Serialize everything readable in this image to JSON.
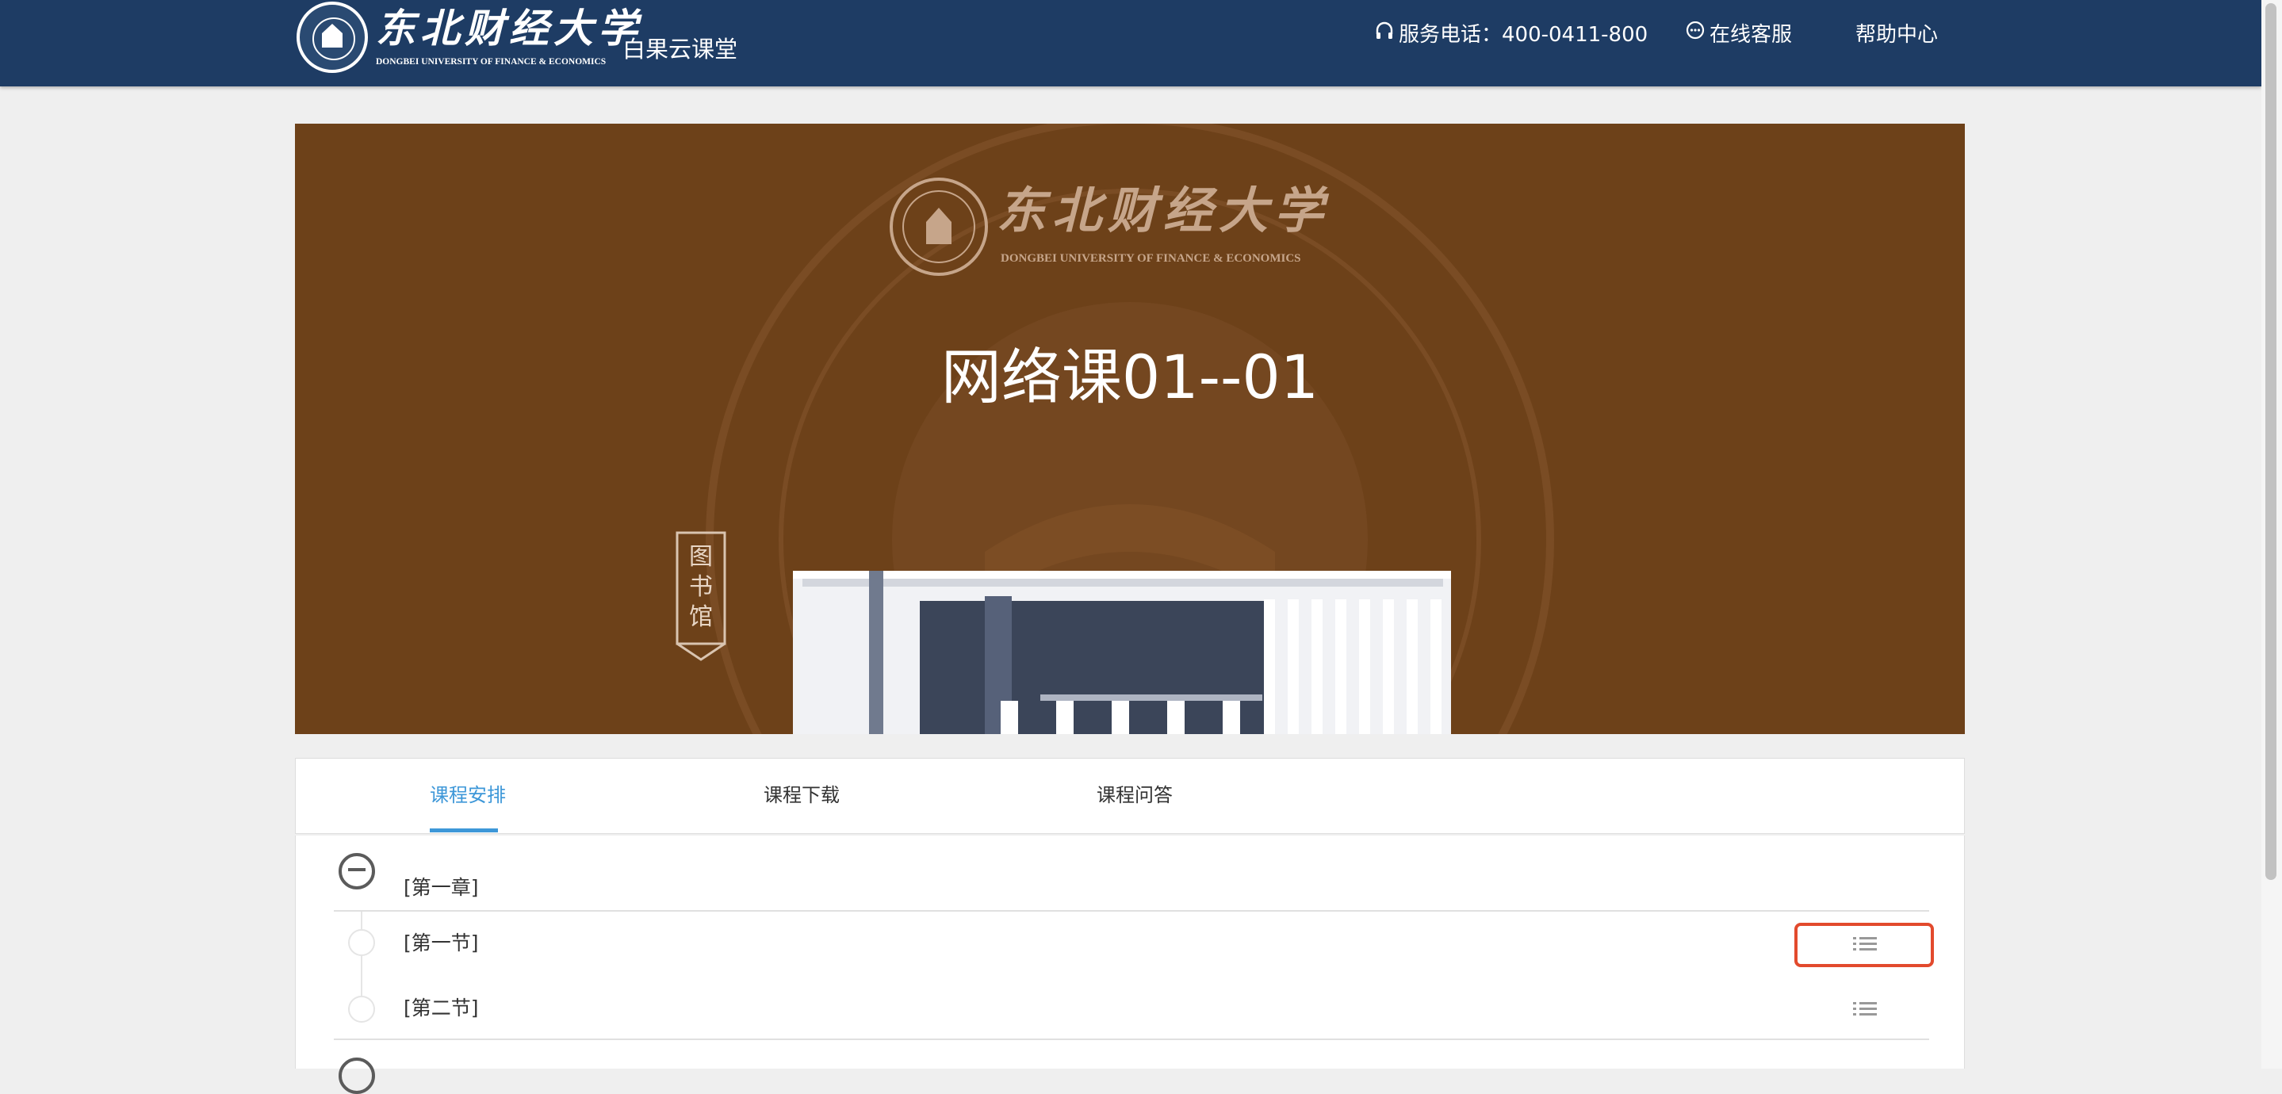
{
  "header": {
    "logo_cn": "东北财经大学",
    "logo_en": "DONGBEI UNIVERSITY OF FINANCE & ECONOMICS",
    "site_name": "白果云课堂",
    "nav": {
      "phone_label": "服务电话：400-0411-800",
      "phone_icon": "headset-icon",
      "service_label": "在线客服",
      "service_icon": "chat-bubble-icon",
      "help_label": "帮助中心"
    }
  },
  "banner": {
    "title": "网络课01--01",
    "logo_cn": "东北财经大学",
    "logo_en": "DONGBEI UNIVERSITY OF FINANCE & ECONOMICS",
    "library_sign": "图书馆",
    "background_color": "#6d4119"
  },
  "tabs": [
    {
      "label": "课程安排",
      "active": true
    },
    {
      "label": "课程下载",
      "active": false
    },
    {
      "label": "课程问答",
      "active": false
    }
  ],
  "course": {
    "chapters": [
      {
        "label": "[第一章]",
        "expanded": true,
        "icon": "collapse-minus-icon",
        "sections": [
          {
            "label": "[第一节]",
            "icon": "list-icon",
            "highlighted": true
          },
          {
            "label": "[第二节]",
            "icon": "list-icon",
            "highlighted": false
          }
        ]
      }
    ]
  },
  "colors": {
    "header": "#1e3c64",
    "accent": "#3d97d8",
    "highlight": "#e24a2d"
  }
}
